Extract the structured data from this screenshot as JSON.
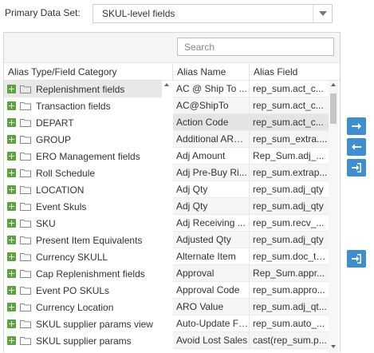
{
  "primary_data_set": {
    "label": "Primary Data Set:",
    "selected": "SKUL-level fields"
  },
  "search": {
    "placeholder": "Search"
  },
  "columns": {
    "category": "Alias Type/Field Category",
    "alias_name": "Alias Name",
    "alias_field": "Alias Field"
  },
  "categories": [
    "Replenishment fields",
    "Transaction fields",
    "DEPART",
    "GROUP",
    "ERO Management fields",
    "Roll Schedule",
    "LOCATION",
    "Event Skuls",
    "SKU",
    "Present Item Equivalents",
    "Currency SKULL",
    "Cap Replenishment fields",
    "Event PO SKULs",
    "Currency Location",
    "SKUL supplier params view",
    "SKUL supplier params"
  ],
  "aliases": [
    {
      "name": "AC @ Ship To ...",
      "field": "rep_sum.act_c..."
    },
    {
      "name": "AC@ShipTo",
      "field": "rep_sum.act_c..."
    },
    {
      "name": "Action Code",
      "field": "rep_sum.act_c..."
    },
    {
      "name": "Additional ARO...",
      "field": "rep_sum_extra...."
    },
    {
      "name": "Adj Amount",
      "field": "Rep_Sum.adj_..."
    },
    {
      "name": "Adj Pre-Buy Ri...",
      "field": "rep_sum.extrap..."
    },
    {
      "name": "Adj Qty",
      "field": "rep_sum.adj_qty"
    },
    {
      "name": "Adj Qty",
      "field": "rep_sum.adj_qty"
    },
    {
      "name": "Adj Receiving ...",
      "field": "rep_sum.recv_..."
    },
    {
      "name": "Adjusted Qty",
      "field": "rep_sum.adj_qty"
    },
    {
      "name": "Alternate Item",
      "field": "rep_sum.doc_text"
    },
    {
      "name": "Approval",
      "field": "Rep_Sum.appr..."
    },
    {
      "name": "Approval Code",
      "field": "rep_sum.appro..."
    },
    {
      "name": "ARO Value",
      "field": "rep_sum.adj_qt..."
    },
    {
      "name": "Auto-Update Flag",
      "field": "rep_sum.auto_..."
    },
    {
      "name": "Avoid Lost Sales",
      "field": "cast(rep_sum.p..."
    }
  ],
  "selection": {
    "category_index": 0,
    "alias_index": 2
  },
  "side_buttons": [
    {
      "icon": "arrow-right-icon"
    },
    {
      "icon": "arrow-left-icon"
    },
    {
      "icon": "sign-in-icon"
    },
    {
      "icon": "sign-in-icon"
    }
  ],
  "colors": {
    "accent": "#3d8fd1",
    "plus_icon": "#5aa43c",
    "selection": "#e4e4e4"
  }
}
